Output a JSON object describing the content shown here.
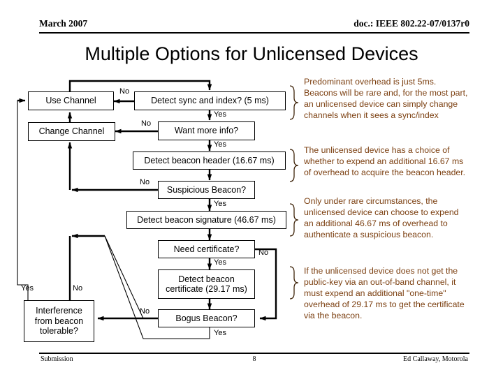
{
  "header": {
    "left": "March 2007",
    "right": "doc.: IEEE 802.22-07/0137r0"
  },
  "title": "Multiple Options for Unlicensed Devices",
  "footer": {
    "left": "Submission",
    "page": "8",
    "right": "Ed Callaway, Motorola"
  },
  "colors": {
    "annotation_text": "#7b3f10",
    "line": "#000000",
    "box_fill": "#ffffff"
  },
  "flow": {
    "nodes": [
      {
        "id": "use-channel",
        "label": "Use Channel"
      },
      {
        "id": "detect-sync",
        "label": "Detect sync and index? (5 ms)"
      },
      {
        "id": "change-channel",
        "label": "Change Channel"
      },
      {
        "id": "want-more-info",
        "label": "Want more info?"
      },
      {
        "id": "detect-beacon-header",
        "label": "Detect beacon header (16.67 ms)"
      },
      {
        "id": "suspicious-beacon",
        "label": "Suspicious Beacon?"
      },
      {
        "id": "detect-beacon-sig",
        "label": "Detect beacon signature (46.67 ms)"
      },
      {
        "id": "need-certificate",
        "label": "Need certificate?"
      },
      {
        "id": "detect-beacon-cert",
        "label": "Detect beacon\ncertificate (29.17 ms)"
      },
      {
        "id": "bogus-beacon",
        "label": "Bogus Beacon?"
      },
      {
        "id": "interference",
        "label": "Interference\nfrom beacon\ntolerable?"
      }
    ],
    "edge_labels": [
      {
        "id": "no-detect-sync",
        "text": "No"
      },
      {
        "id": "yes-detect-sync",
        "text": "Yes"
      },
      {
        "id": "no-want-more-info",
        "text": "No"
      },
      {
        "id": "yes-want-more-info",
        "text": "Yes"
      },
      {
        "id": "no-suspicious",
        "text": "No"
      },
      {
        "id": "yes-suspicious",
        "text": "Yes"
      },
      {
        "id": "no-need-certificate",
        "text": "No"
      },
      {
        "id": "yes-need-certificate",
        "text": "Yes"
      },
      {
        "id": "no-bogus-beacon",
        "text": "No"
      },
      {
        "id": "yes-bogus-beacon",
        "text": "Yes"
      },
      {
        "id": "yes-interference",
        "text": "Yes"
      },
      {
        "id": "no-interference",
        "text": "No"
      }
    ]
  },
  "annotations": [
    {
      "id": "annotation-5ms",
      "text": "Predominant overhead is just 5ms.\nBeacons will be rare and, for the most part,\nan unlicensed device can simply change\nchannels when it sees a sync/index"
    },
    {
      "id": "annotation-header",
      "text": "The unlicensed device has a choice of\nwhether to expend an additional 16.67 ms\nof overhead to acquire the beacon header."
    },
    {
      "id": "annotation-signature",
      "text": "Only under rare circumstances, the\nunlicensed device can choose to expend\nan additional 46.67 ms of overhead to\nauthenticate a suspicious beacon."
    },
    {
      "id": "annotation-certificate",
      "text": "If the unlicensed device does not get the\npublic-key via an out-of-band channel, it\nmust expend an additional \"one-time\"\noverhead of 29.17 ms to get the certificate\nvia the beacon."
    }
  ]
}
